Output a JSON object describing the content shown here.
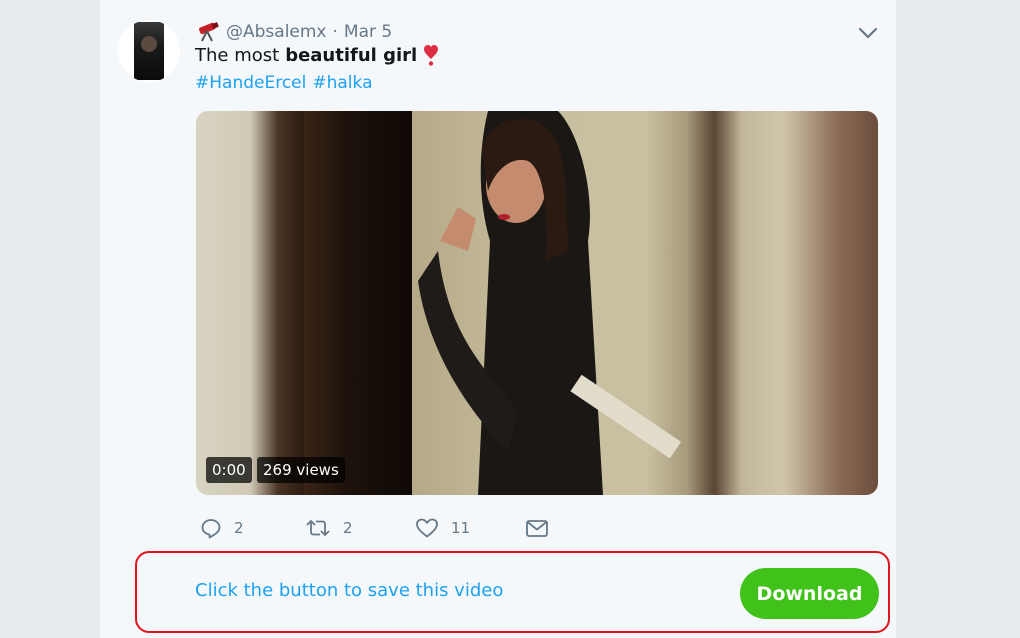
{
  "tweet": {
    "handle": "@Absalemx",
    "separator": "·",
    "date": "Mar 5",
    "text_plain": "The most",
    "text_bold": "beautiful girl",
    "hashtags": [
      "#HandeErcel",
      "#halka"
    ],
    "icons": {
      "author_emoji": "telescope-icon",
      "text_emoji": "heart-exclamation-icon",
      "menu": "chevron-down-icon"
    }
  },
  "video": {
    "time": "0:00",
    "views": "269 views"
  },
  "actions": {
    "reply_count": "2",
    "retweet_count": "2",
    "like_count": "11",
    "icons": [
      "reply-icon",
      "retweet-icon",
      "like-icon",
      "direct-message-icon"
    ]
  },
  "download": {
    "prompt": "Click the button to save this video",
    "button_label": "Download"
  },
  "colors": {
    "link": "#1da1f2",
    "download_button": "#41c21a",
    "panel_border": "#e0141e",
    "muted_text": "#657786"
  }
}
